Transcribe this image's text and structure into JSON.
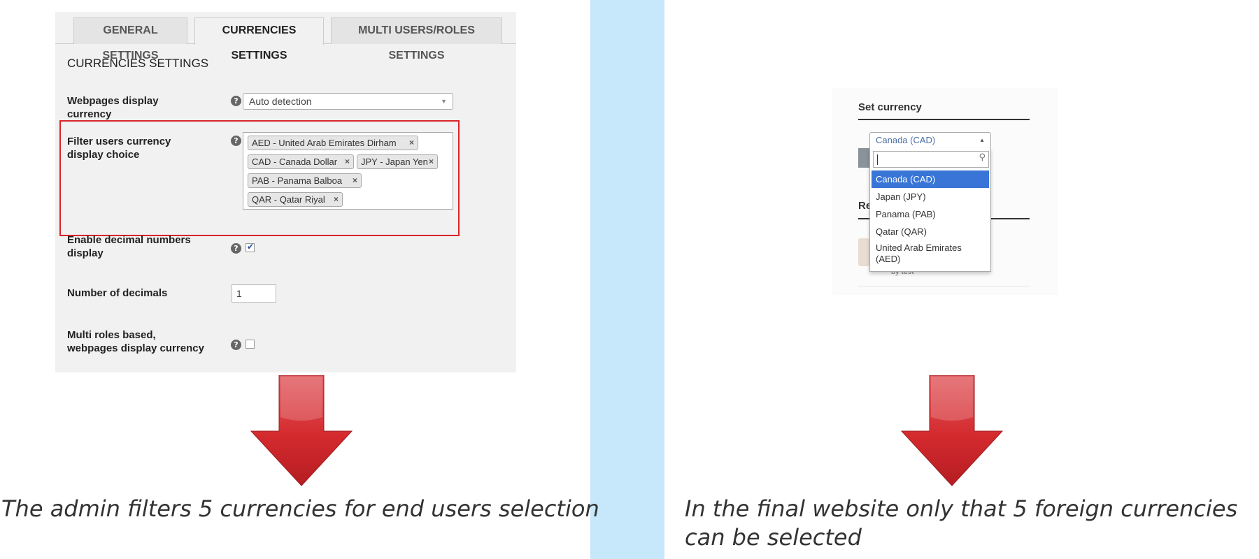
{
  "admin": {
    "tabs": [
      {
        "label": "GENERAL SETTINGS",
        "active": false
      },
      {
        "label": "CURRENCIES SETTINGS",
        "active": true
      },
      {
        "label": "MULTI USERS/ROLES SETTINGS",
        "active": false
      }
    ],
    "section_title": "CURRENCIES SETTINGS",
    "rows": {
      "display_currency": {
        "label": "Webpages display currency",
        "value": "Auto detection"
      },
      "filter": {
        "label": "Filter users currency display choice",
        "chips": [
          "AED - United Arab Emirates Dirham",
          "CAD - Canada Dollar",
          "JPY - Japan Yen",
          "PAB - Panama Balboa",
          "QAR - Qatar Riyal"
        ]
      },
      "decimal": {
        "label": "Enable decimal numbers display",
        "checked": true
      },
      "num_decimals": {
        "label": "Number of decimals",
        "value": "1"
      },
      "multi_roles": {
        "label": "Multi roles based, webpages display currency",
        "checked": false
      }
    },
    "help_glyph": "?",
    "remove_glyph": "×"
  },
  "widget": {
    "title": "Set currency",
    "selected": "Canada (CAD)",
    "options": [
      "Canada (CAD)",
      "Japan (JPY)",
      "Panama (PAB)",
      "Qatar (QAR)",
      "United Arab Emirates (AED)"
    ],
    "highlighted_index": 0,
    "partial_heading": "Re",
    "partial_by": "by test"
  },
  "captions": {
    "left": "The admin filters 5 currencies for end users selection",
    "right": "In the final website only that 5 foreign currencies can be selected"
  },
  "colors": {
    "highlight_border": "#d9252b",
    "divider_band": "#c7e7fb",
    "arrow_red": "#d42a2e",
    "option_highlight": "#3875d7"
  },
  "icons": {
    "help": "help-icon",
    "remove": "close-icon",
    "dropdown": "chevron-down-icon",
    "search": "search-icon",
    "arrow": "arrow-down-icon"
  }
}
